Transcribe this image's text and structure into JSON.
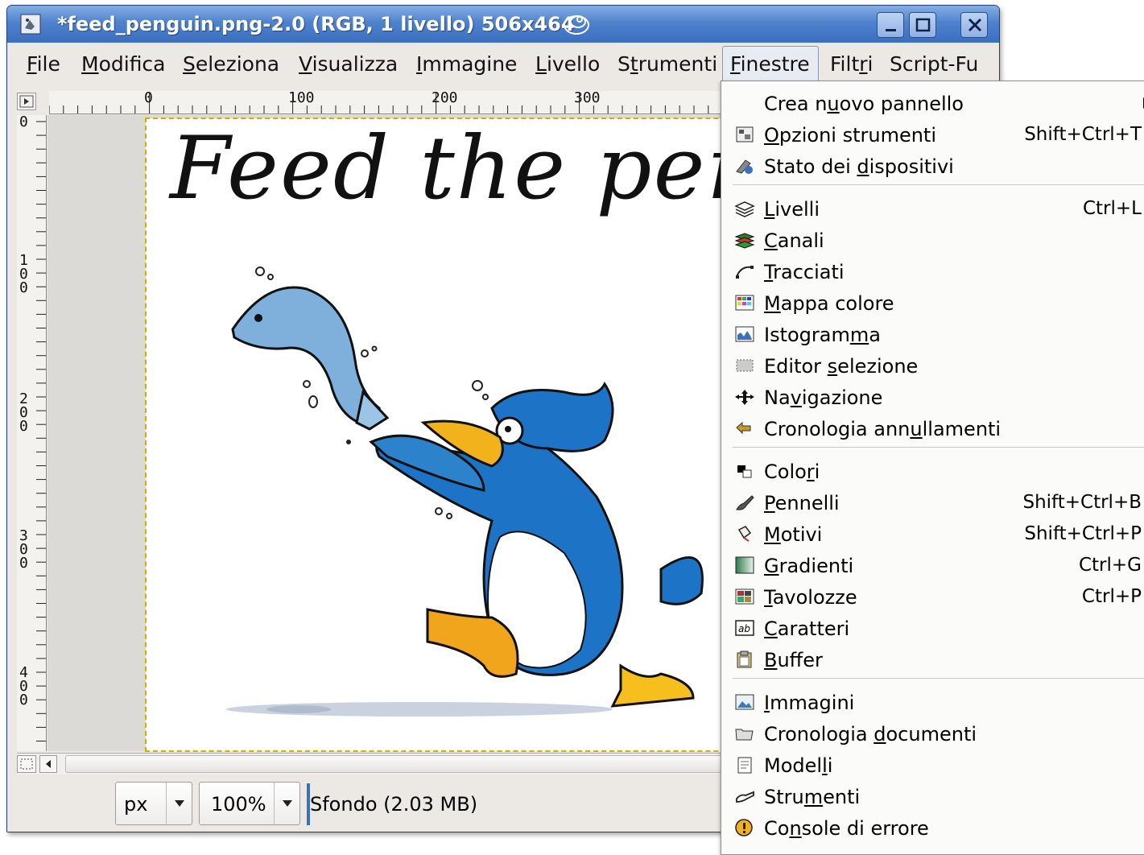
{
  "window": {
    "title": "*feed_penguin.png-2.0 (RGB, 1 livello) 506x464",
    "colors": {
      "titlebar": "#4f82cd",
      "accent": "#3b6fbf"
    }
  },
  "menubar": {
    "items": [
      {
        "pre": "",
        "u": "F",
        "post": "ile"
      },
      {
        "pre": "",
        "u": "M",
        "post": "odifica"
      },
      {
        "pre": "",
        "u": "S",
        "post": "eleziona"
      },
      {
        "pre": "",
        "u": "V",
        "post": "isualizza"
      },
      {
        "pre": "",
        "u": "I",
        "post": "mmagine"
      },
      {
        "pre": "",
        "u": "L",
        "post": "ivello"
      },
      {
        "pre": "S",
        "u": "t",
        "post": "rumenti"
      },
      {
        "pre": "",
        "u": "F",
        "post": "inestre"
      },
      {
        "pre": "Filt",
        "u": "r",
        "post": "i"
      },
      {
        "pre": "Script-Fu",
        "u": "",
        "post": ""
      }
    ]
  },
  "ruler": {
    "h_labels": [
      "0",
      "100",
      "200",
      "300"
    ],
    "v_labels": [
      "0",
      "1\n0\n0",
      "2\n0\n0",
      "3\n0\n0",
      "4\n0\n0"
    ]
  },
  "image": {
    "headline": "Feed the pengu"
  },
  "statusbar": {
    "unit": "px",
    "zoom": "100%",
    "info": "Sfondo (2.03 MB)"
  },
  "finestre_menu": {
    "items": [
      {
        "pre": "Crea n",
        "u": "u",
        "post": "ovo pannello",
        "shortcut": "",
        "icon": "none",
        "submenu": true
      },
      {
        "pre": "",
        "u": "O",
        "post": "pzioni strumenti",
        "shortcut": "Shift+Ctrl+T",
        "icon": "tool-options-icon"
      },
      {
        "pre": "Stato dei ",
        "u": "d",
        "post": "ispositivi",
        "shortcut": "",
        "icon": "device-status-icon"
      },
      {
        "pre": "",
        "u": "L",
        "post": "ivelli",
        "shortcut": "Ctrl+L",
        "icon": "layers-icon"
      },
      {
        "pre": "",
        "u": "C",
        "post": "anali",
        "shortcut": "",
        "icon": "channels-icon"
      },
      {
        "pre": "",
        "u": "T",
        "post": "racciati",
        "shortcut": "",
        "icon": "paths-icon"
      },
      {
        "pre": "",
        "u": "M",
        "post": "appa colore",
        "shortcut": "",
        "icon": "colormap-icon"
      },
      {
        "pre": "Istogram",
        "u": "m",
        "post": "a",
        "shortcut": "",
        "icon": "histogram-icon"
      },
      {
        "pre": "Editor ",
        "u": "s",
        "post": "elezione",
        "shortcut": "",
        "icon": "selection-editor-icon"
      },
      {
        "pre": "Na",
        "u": "v",
        "post": "igazione",
        "shortcut": "",
        "icon": "navigation-icon"
      },
      {
        "pre": "Cronologia ann",
        "u": "u",
        "post": "llamenti",
        "shortcut": "",
        "icon": "undo-history-icon"
      },
      {
        "pre": "Colo",
        "u": "r",
        "post": "i",
        "shortcut": "",
        "icon": "colors-icon"
      },
      {
        "pre": "",
        "u": "P",
        "post": "ennelli",
        "shortcut": "Shift+Ctrl+B",
        "icon": "brushes-icon"
      },
      {
        "pre": "",
        "u": "M",
        "post": "otivi",
        "shortcut": "Shift+Ctrl+P",
        "icon": "patterns-icon"
      },
      {
        "pre": "",
        "u": "G",
        "post": "radienti",
        "shortcut": "Ctrl+G",
        "icon": "gradients-icon"
      },
      {
        "pre": "",
        "u": "T",
        "post": "avolozze",
        "shortcut": "Ctrl+P",
        "icon": "palettes-icon"
      },
      {
        "pre": "",
        "u": "C",
        "post": "aratteri",
        "shortcut": "",
        "icon": "fonts-icon"
      },
      {
        "pre": "",
        "u": "B",
        "post": "uffer",
        "shortcut": "",
        "icon": "buffer-icon"
      },
      {
        "pre": "",
        "u": "I",
        "post": "mmagini",
        "shortcut": "",
        "icon": "images-icon"
      },
      {
        "pre": "Cronologia ",
        "u": "d",
        "post": "ocumenti",
        "shortcut": "",
        "icon": "document-history-icon"
      },
      {
        "pre": "Model",
        "u": "l",
        "post": "i",
        "shortcut": "",
        "icon": "templates-icon"
      },
      {
        "pre": "Stru",
        "u": "m",
        "post": "enti",
        "shortcut": "",
        "icon": "tools-icon"
      },
      {
        "pre": "Co",
        "u": "n",
        "post": "sole di errore",
        "shortcut": "",
        "icon": "error-console-icon"
      }
    ]
  }
}
